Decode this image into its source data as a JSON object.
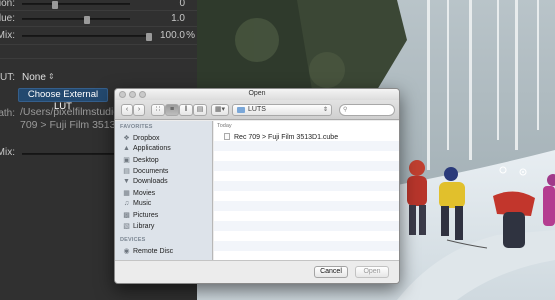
{
  "inspector": {
    "rows": [
      {
        "label": "ation:",
        "value": "0",
        "unit": ""
      },
      {
        "label": "alue:",
        "value": "1.0",
        "unit": ""
      },
      {
        "label": "Mix:",
        "value": "100.0",
        "unit": "%"
      }
    ],
    "lut_label": "LUT:",
    "lut_value": "None",
    "choose_button": "Choose External LUT",
    "path_label": "ath:",
    "path_line1": "/Users/pixelfilmstudios",
    "path_line2": "709 > Fuji Film 3513D1",
    "mix2_label": "Mix:"
  },
  "dialog": {
    "title": "Open",
    "folder": "LUTS",
    "sidebar": {
      "favorites_header": "FAVORITES",
      "favorites": [
        {
          "label": "Dropbox",
          "icon": "dropbox-icon"
        },
        {
          "label": "Applications",
          "icon": "applications-icon"
        },
        {
          "label": "Desktop",
          "icon": "desktop-icon"
        },
        {
          "label": "Documents",
          "icon": "documents-icon"
        },
        {
          "label": "Downloads",
          "icon": "downloads-icon"
        },
        {
          "label": "Movies",
          "icon": "movies-icon"
        },
        {
          "label": "Music",
          "icon": "music-icon"
        },
        {
          "label": "Pictures",
          "icon": "pictures-icon"
        },
        {
          "label": "Library",
          "icon": "library-icon"
        }
      ],
      "devices_header": "DEVICES",
      "devices": [
        {
          "label": "Remote Disc",
          "icon": "disc-icon"
        }
      ]
    },
    "section_header": "Today",
    "files": [
      {
        "name": "Rec 709 > Fuji Film 3513D1.cube"
      }
    ],
    "cancel_label": "Cancel",
    "open_label": "Open"
  }
}
